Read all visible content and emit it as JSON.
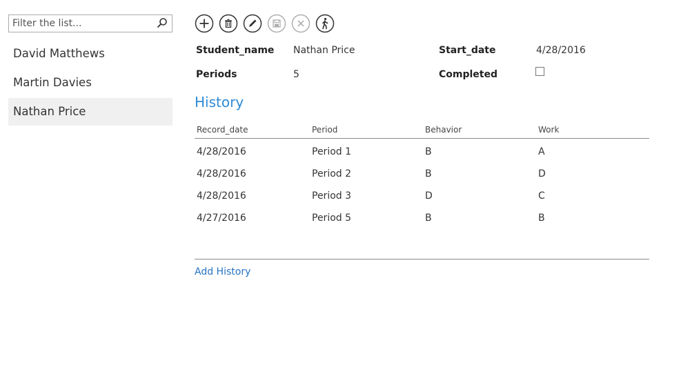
{
  "filter": {
    "placeholder": "Filter the list...",
    "value": ""
  },
  "list": {
    "items": [
      {
        "label": "David Matthews",
        "selected": false
      },
      {
        "label": "Martin Davies",
        "selected": false
      },
      {
        "label": "Nathan Price",
        "selected": true
      }
    ]
  },
  "toolbar": {
    "buttons": [
      {
        "name": "add",
        "icon": "plus-circle-icon",
        "enabled": true
      },
      {
        "name": "delete",
        "icon": "trash-circle-icon",
        "enabled": true
      },
      {
        "name": "edit",
        "icon": "pencil-circle-icon",
        "enabled": true
      },
      {
        "name": "save",
        "icon": "save-circle-icon",
        "enabled": false
      },
      {
        "name": "cancel",
        "icon": "x-circle-icon",
        "enabled": false
      },
      {
        "name": "walk",
        "icon": "walking-person-circle-icon",
        "enabled": true
      }
    ]
  },
  "fields": {
    "student_name_label": "Student_name",
    "student_name_value": "Nathan Price",
    "start_date_label": "Start_date",
    "start_date_value": "4/28/2016",
    "periods_label": "Periods",
    "periods_value": "5",
    "completed_label": "Completed",
    "completed_checked": false
  },
  "history": {
    "title": "History",
    "columns": [
      "Record_date",
      "Period",
      "Behavior",
      "Work"
    ],
    "rows": [
      [
        "4/28/2016",
        "Period 1",
        "B",
        "A"
      ],
      [
        "4/28/2016",
        "Period 2",
        "B",
        "D"
      ],
      [
        "4/28/2016",
        "Period 3",
        "D",
        "C"
      ],
      [
        "4/27/2016",
        "Period 5",
        "B",
        "B"
      ]
    ],
    "add_label": "Add History"
  },
  "colors": {
    "accent": "#2e8bd6",
    "link": "#2673c2",
    "selected_bg": "#f0f0f0",
    "icon": "#333333",
    "icon_disabled": "#b0b0b0"
  }
}
